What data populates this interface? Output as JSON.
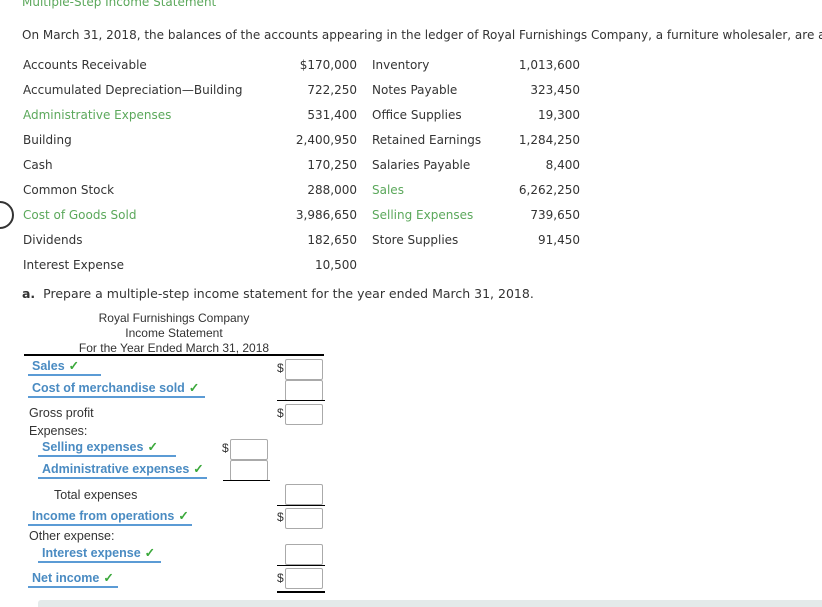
{
  "title": "Multiple-Step Income Statement",
  "intro": "On March 31, 2018, the balances of the accounts appearing in the ledger of Royal Furnishings Company, a furniture wholesaler, are a",
  "ledger": {
    "left": [
      {
        "name": "Accounts Receivable",
        "value": "$170,000",
        "highlight": false
      },
      {
        "name": "Accumulated Depreciation—Building",
        "value": "722,250",
        "highlight": false
      },
      {
        "name": "Administrative Expenses",
        "value": "531,400",
        "highlight": true
      },
      {
        "name": "Building",
        "value": "2,400,950",
        "highlight": false
      },
      {
        "name": "Cash",
        "value": "170,250",
        "highlight": false
      },
      {
        "name": "Common Stock",
        "value": "288,000",
        "highlight": false
      },
      {
        "name": "Cost of Goods Sold",
        "value": "3,986,650",
        "highlight": true
      },
      {
        "name": "Dividends",
        "value": "182,650",
        "highlight": false
      },
      {
        "name": "Interest Expense",
        "value": "10,500",
        "highlight": false
      }
    ],
    "right": [
      {
        "name": "Inventory",
        "value": "1,013,600",
        "highlight": false
      },
      {
        "name": "Notes Payable",
        "value": "323,450",
        "highlight": false
      },
      {
        "name": "Office Supplies",
        "value": "19,300",
        "highlight": false
      },
      {
        "name": "Retained Earnings",
        "value": "1,284,250",
        "highlight": false
      },
      {
        "name": "Salaries Payable",
        "value": "8,400",
        "highlight": false
      },
      {
        "name": "Sales",
        "value": "6,262,250",
        "highlight": true
      },
      {
        "name": "Selling Expenses",
        "value": "739,650",
        "highlight": true
      },
      {
        "name": "Store Supplies",
        "value": "91,450",
        "highlight": false
      }
    ]
  },
  "question": {
    "label": "a.",
    "text": "Prepare a multiple-step income statement for the year ended March 31, 2018."
  },
  "statement": {
    "company": "Royal Furnishings Company",
    "name": "Income Statement",
    "period": "For the Year Ended March 31, 2018",
    "currency_symbol": "$",
    "check": "✓",
    "rows": {
      "sales": "Sales",
      "cogs": "Cost of merchandise sold",
      "gross_profit": "Gross profit",
      "expenses": "Expenses:",
      "selling": "Selling expenses",
      "admin": "Administrative expenses",
      "total_expenses": "Total expenses",
      "income_ops": "Income from operations",
      "other_expense": "Other expense:",
      "interest": "Interest expense",
      "net_income": "Net income"
    },
    "inputs": {
      "sales": "",
      "cogs": "",
      "gross_profit": "",
      "selling": "",
      "admin": "",
      "total_expenses": "",
      "income_ops": "",
      "interest": "",
      "net_income": ""
    }
  }
}
